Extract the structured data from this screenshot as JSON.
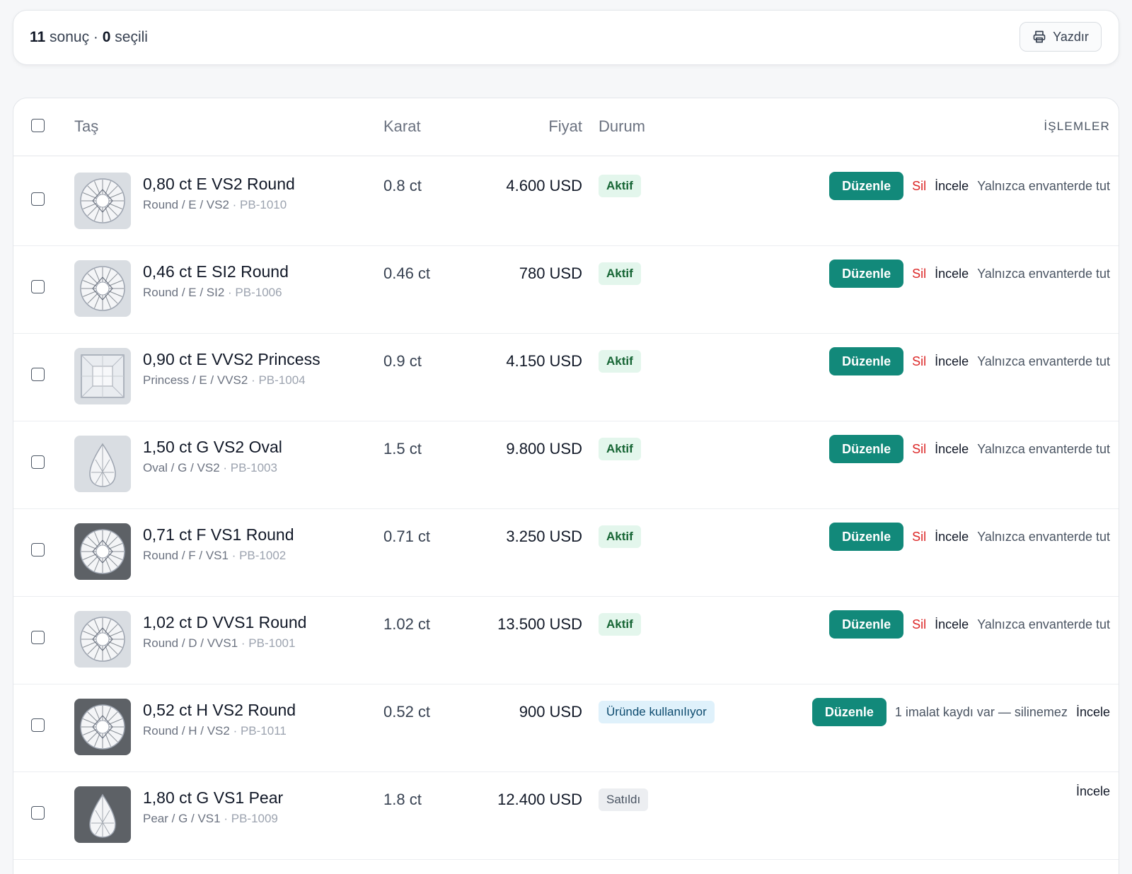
{
  "summary": {
    "count": "11",
    "count_suffix": "sonuç ·",
    "selected": "0",
    "selected_suffix": "seçili"
  },
  "toolbar": {
    "print_label": "Yazdır",
    "print_icon": "printer-icon"
  },
  "table": {
    "headers": {
      "stone": "Taş",
      "carat": "Karat",
      "price": "Fiyat",
      "status": "Durum",
      "actions": "İŞLEMLER"
    },
    "rows": [
      {
        "title": "0,80 ct E VS2 Round",
        "spec": "Round / E / VS2",
        "code": "· PB-1010",
        "carat": "0.8 ct",
        "price": "4.600 USD",
        "status": "Aktif",
        "status_kind": "active",
        "shape": "round",
        "tone": "light",
        "edit": "Düzenle",
        "delete": "Sil",
        "view": "İncele",
        "keep": "Yalnızca envanterde tut"
      },
      {
        "title": "0,46 ct E SI2 Round",
        "spec": "Round / E / SI2",
        "code": "· PB-1006",
        "carat": "0.46 ct",
        "price": "780 USD",
        "status": "Aktif",
        "status_kind": "active",
        "shape": "round",
        "tone": "light",
        "edit": "Düzenle",
        "delete": "Sil",
        "view": "İncele",
        "keep": "Yalnızca envanterde tut"
      },
      {
        "title": "0,90 ct E VVS2 Princess",
        "spec": "Princess / E / VVS2",
        "code": "· PB-1004",
        "carat": "0.9 ct",
        "price": "4.150 USD",
        "status": "Aktif",
        "status_kind": "active",
        "shape": "princess",
        "tone": "light",
        "edit": "Düzenle",
        "delete": "Sil",
        "view": "İncele",
        "keep": "Yalnızca envanterde tut"
      },
      {
        "title": "1,50 ct G VS2 Oval",
        "spec": "Oval / G / VS2",
        "code": "· PB-1003",
        "carat": "1.5 ct",
        "price": "9.800 USD",
        "status": "Aktif",
        "status_kind": "active",
        "shape": "pear",
        "tone": "light",
        "edit": "Düzenle",
        "delete": "Sil",
        "view": "İncele",
        "keep": "Yalnızca envanterde tut"
      },
      {
        "title": "0,71 ct F VS1 Round",
        "spec": "Round / F / VS1",
        "code": "· PB-1002",
        "carat": "0.71 ct",
        "price": "3.250 USD",
        "status": "Aktif",
        "status_kind": "active",
        "shape": "round",
        "tone": "dark",
        "edit": "Düzenle",
        "delete": "Sil",
        "view": "İncele",
        "keep": "Yalnızca envanterde tut"
      },
      {
        "title": "1,02 ct D VVS1 Round",
        "spec": "Round / D / VVS1",
        "code": "· PB-1001",
        "carat": "1.02 ct",
        "price": "13.500 USD",
        "status": "Aktif",
        "status_kind": "active",
        "shape": "round",
        "tone": "light",
        "edit": "Düzenle",
        "delete": "Sil",
        "view": "İncele",
        "keep": "Yalnızca envanterde tut"
      },
      {
        "title": "0,52 ct H VS2 Round",
        "spec": "Round / H / VS2",
        "code": "· PB-1011",
        "carat": "0.52 ct",
        "price": "900 USD",
        "status": "Üründe kullanılıyor",
        "status_kind": "inuse",
        "shape": "round",
        "tone": "dark",
        "edit": "Düzenle",
        "note": "1 imalat kaydı var — silinemez",
        "view": "İncele"
      },
      {
        "title": "1,80 ct G VS1 Pear",
        "spec": "Pear / G / VS1",
        "code": "· PB-1009",
        "carat": "1.8 ct",
        "price": "12.400 USD",
        "status": "Satıldı",
        "status_kind": "sold",
        "shape": "pear",
        "tone": "dark",
        "view": "İncele"
      }
    ]
  },
  "colors": {
    "accent": "#12897a",
    "danger": "#dc2626"
  }
}
